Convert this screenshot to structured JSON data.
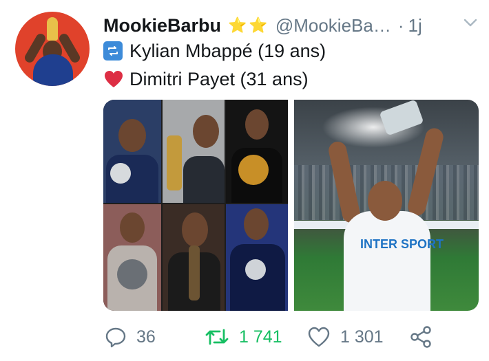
{
  "tweet": {
    "display_name": "MookieBarbu",
    "badges": "⭐⭐",
    "handle": "@MookieBa…",
    "separator": "·",
    "time": "1j",
    "lines": [
      {
        "icon": "repeat-emoji-icon",
        "text": "Kylian Mbappé (19 ans)"
      },
      {
        "icon": "red-heart-emoji-icon",
        "text": "Dimitri Payet (31 ans)"
      }
    ]
  },
  "media": {
    "left_image": "collage-photo",
    "right_image": "stadium-photo",
    "sponsor_text": "INTER SPORT"
  },
  "actions": {
    "reply_count": "36",
    "retweet_count": "1 741",
    "like_count": "1 301"
  },
  "colors": {
    "text": "#14171a",
    "secondary": "#657786",
    "retweet_active": "#17bf63",
    "star": "#f5b324"
  }
}
